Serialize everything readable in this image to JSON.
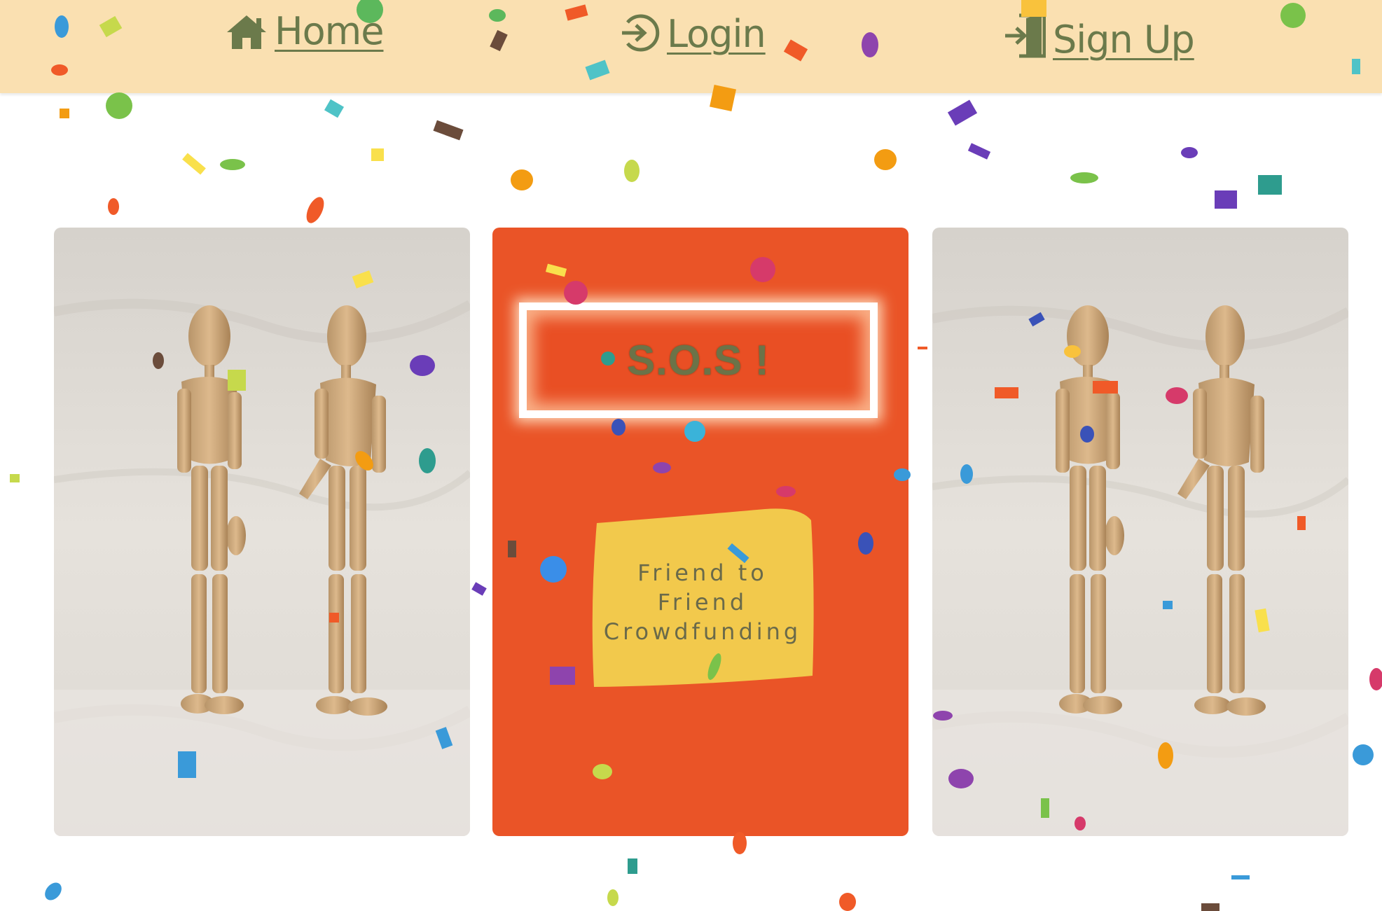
{
  "nav": {
    "home_label": "Home",
    "login_label": "Login",
    "signup_label": "Sign Up",
    "home_icon": "home-icon",
    "login_icon": "login-icon",
    "signup_icon": "signup-icon",
    "background_color": "#fae0b1",
    "text_color": "#6b7a4b"
  },
  "cards": {
    "center": {
      "title": "S.O.S !",
      "tagline_line1": "Friend to Friend",
      "tagline_line2": "Crowdfunding",
      "background_color": "#ea5427",
      "tagline_box_color": "#f2c94c"
    },
    "side_image": "wooden-mannequins-photo"
  },
  "decoration": "confetti"
}
